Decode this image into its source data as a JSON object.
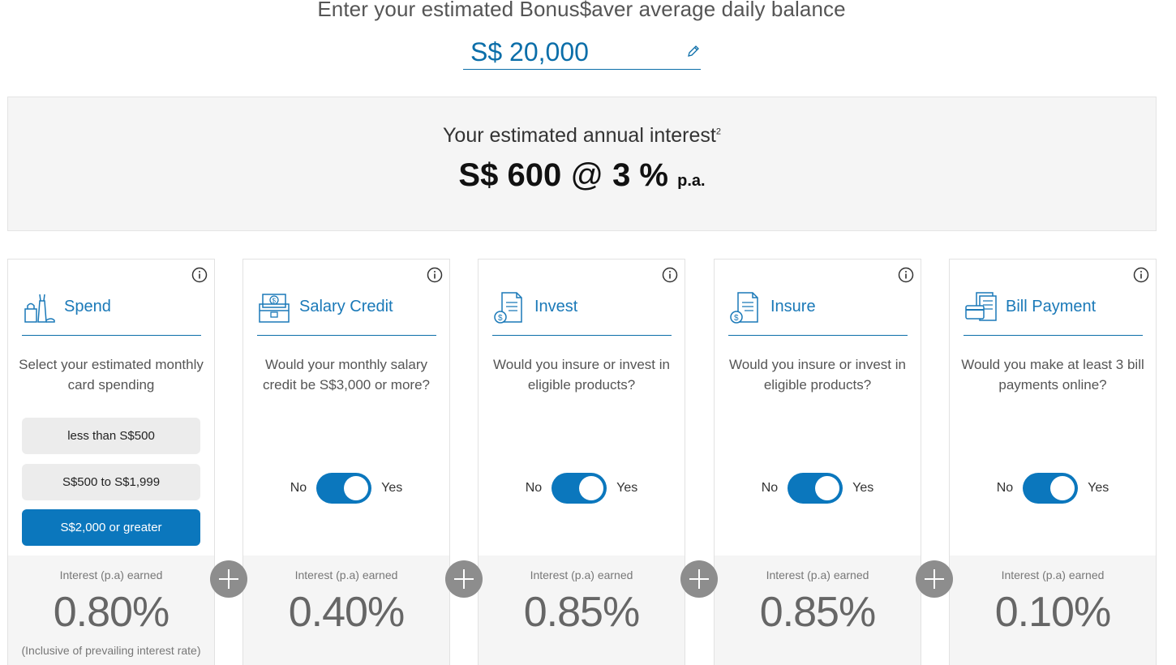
{
  "header": {
    "title": "Enter your estimated Bonus$aver average daily balance",
    "balance_value": "S$ 20,000"
  },
  "result": {
    "label": "Your estimated annual interest",
    "label_sup": "2",
    "amount": "S$ 600",
    "at": "@",
    "rate": "3 %",
    "pa": "p.a."
  },
  "colors": {
    "accent": "#0b77bd",
    "text_blue": "#1a79b8",
    "panel_bg": "#f5f5f5"
  },
  "cards": [
    {
      "title": "Spend",
      "icon": "shopping-bags-icon",
      "question": "Select your estimated monthly card spending",
      "options": [
        "less than S$500",
        "S$500 to S$1,999",
        "S$2,000 or greater"
      ],
      "selected_option": "S$2,000 or greater",
      "interest_label": "Interest (p.a) earned",
      "interest_rate": "0.80%",
      "note": "(Inclusive of prevailing interest rate)"
    },
    {
      "title": "Salary Credit",
      "icon": "cash-tray-icon",
      "question": "Would your monthly salary credit be S$3,000 or more?",
      "toggle_no": "No",
      "toggle_yes": "Yes",
      "toggle_on": true,
      "interest_label": "Interest (p.a) earned",
      "interest_rate": "0.40%"
    },
    {
      "title": "Invest",
      "icon": "document-dollar-icon",
      "question": "Would you insure or invest in eligible products?",
      "toggle_no": "No",
      "toggle_yes": "Yes",
      "toggle_on": true,
      "interest_label": "Interest (p.a) earned",
      "interest_rate": "0.85%"
    },
    {
      "title": "Insure",
      "icon": "document-dollar-icon",
      "question": "Would you insure or invest in eligible products?",
      "toggle_no": "No",
      "toggle_yes": "Yes",
      "toggle_on": true,
      "interest_label": "Interest (p.a) earned",
      "interest_rate": "0.85%"
    },
    {
      "title": "Bill Payment",
      "icon": "bills-card-icon",
      "question": "Would you make at least 3 bill payments online?",
      "toggle_no": "No",
      "toggle_yes": "Yes",
      "toggle_on": true,
      "interest_label": "Interest (p.a) earned",
      "interest_rate": "0.10%"
    }
  ]
}
